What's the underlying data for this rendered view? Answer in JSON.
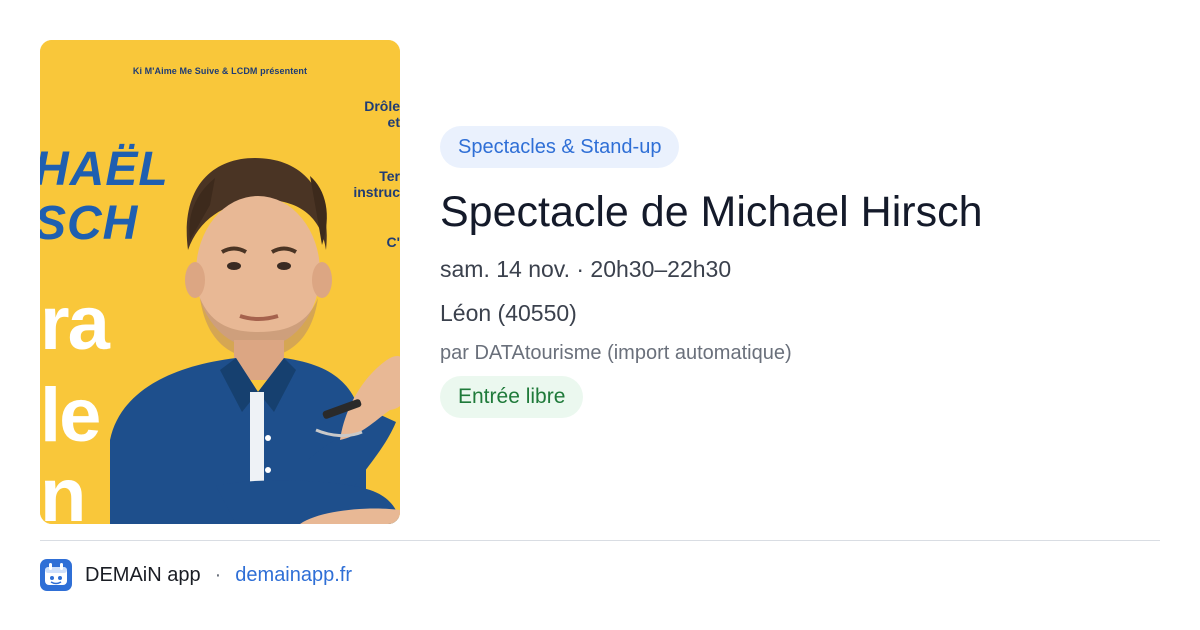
{
  "poster": {
    "presenter": "Ki M'Aime Me Suive & LCDM présentent",
    "name_line1": "HAËL",
    "name_line2": "SCH",
    "side_line1": "Drôle\net",
    "side_line2": "Ter\ninstruc",
    "side_line3": "C'",
    "big_line1": "ra",
    "big_line2": "le",
    "big_line3": "n",
    "colors": {
      "background": "#f9c73a",
      "shirt": "#1e4f8c",
      "name": "#1f5fb0"
    }
  },
  "event": {
    "category": "Spectacles & Stand-up",
    "title": "Spectacle de Michael Hirsch",
    "date_time": "sam. 14 nov. · 20h30–22h30",
    "place": "Léon (40550)",
    "source": "par DATAtourisme (import automatique)",
    "price": "Entrée libre"
  },
  "footer": {
    "app_name": "DEMAiN app",
    "separator": "·",
    "url": "demainapp.fr",
    "icon": "demain-app-icon"
  },
  "colors": {
    "accent": "#2f6fd6",
    "category_bg": "#eaf1fd",
    "price_bg": "#ebf8ef",
    "price_text": "#1f7a3a",
    "title": "#141a2a"
  }
}
